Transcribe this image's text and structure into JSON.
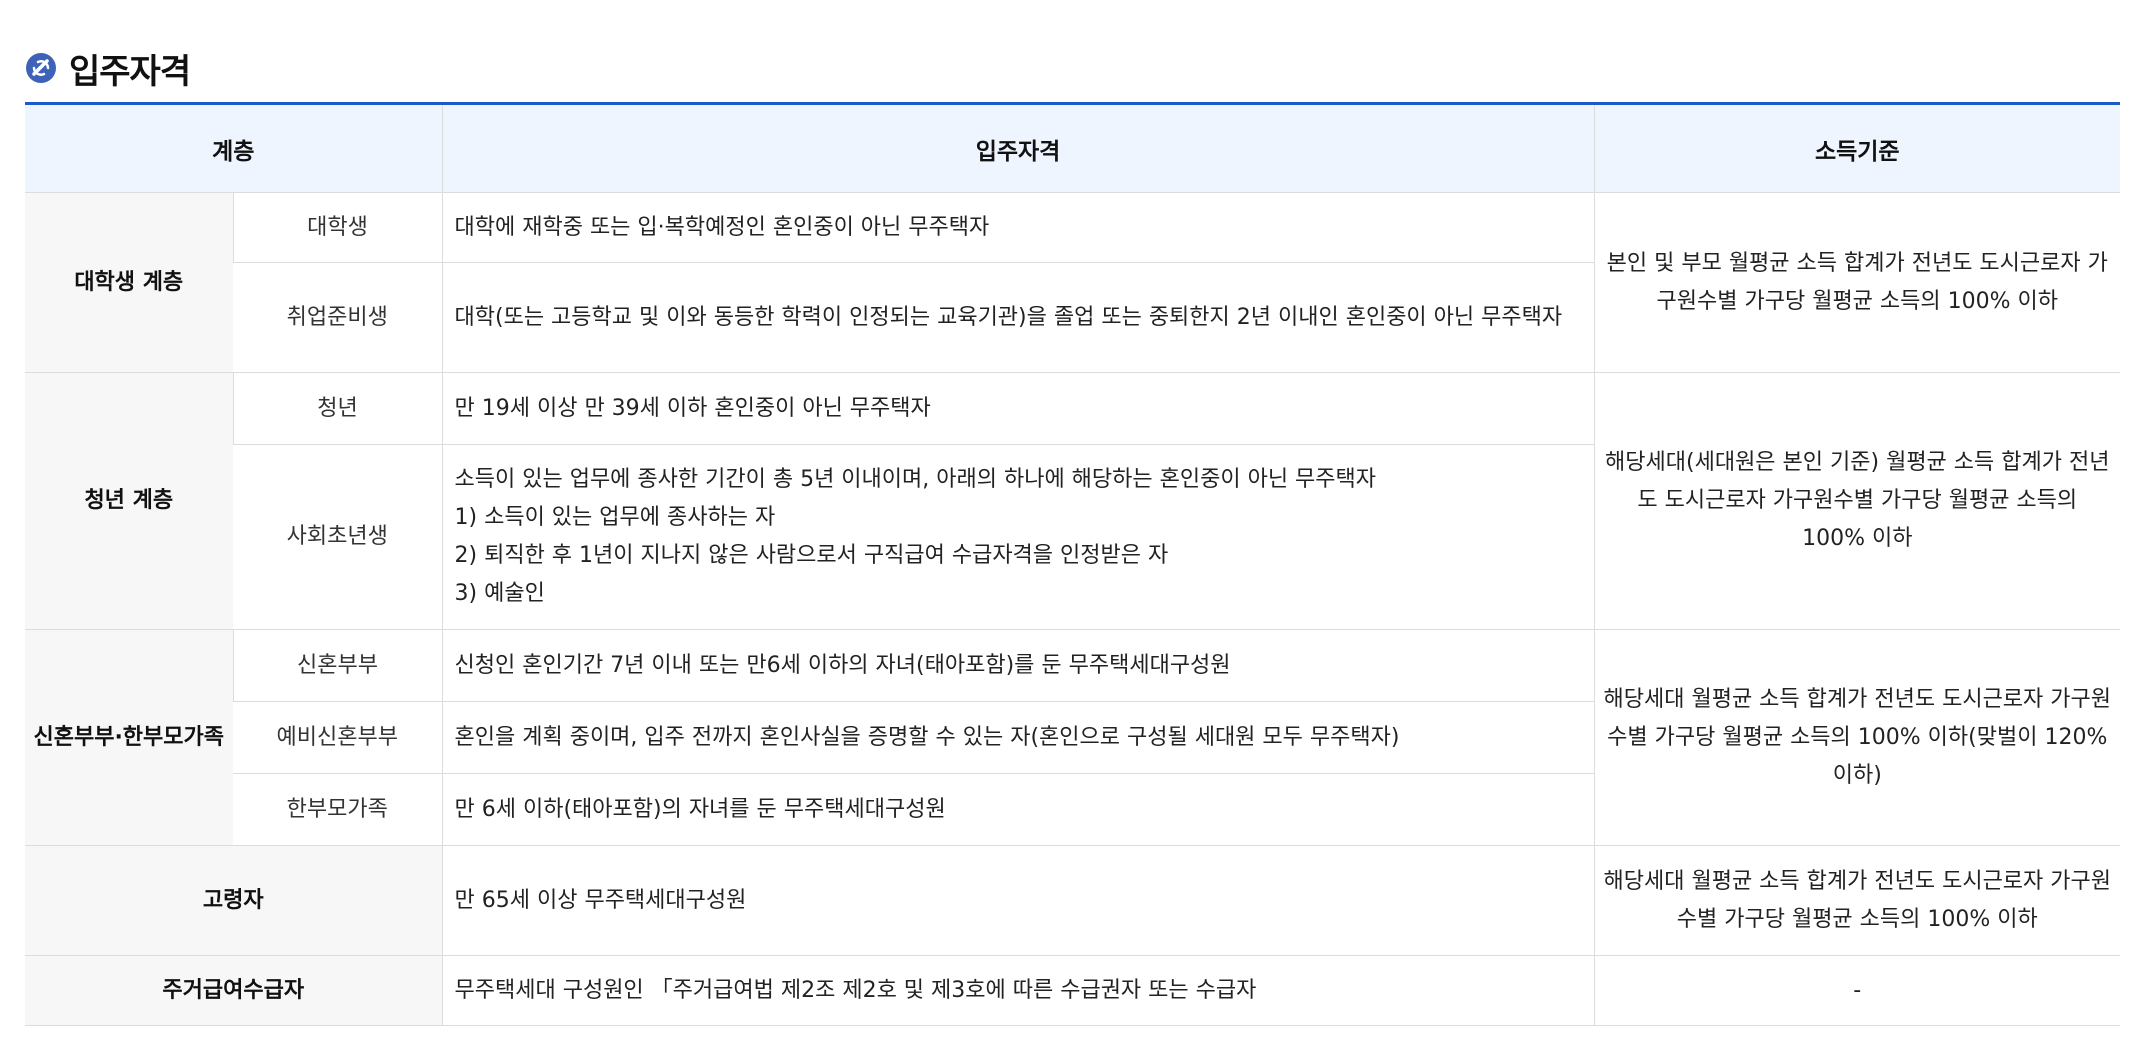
{
  "section": {
    "title": "입주자격",
    "icon": "section-title-icon",
    "accent_color": "#1f58c7"
  },
  "table": {
    "headers": [
      "계층",
      "입주자격",
      "소득기준"
    ],
    "groups": [
      {
        "category": "대학생 계층",
        "income": "본인 및 부모 월평균 소득 합계가 전년도 도시근로자 가구원수별 가구당 월평균 소득의 100% 이하",
        "rows": [
          {
            "type": "대학생",
            "qualification": [
              "대학에 재학중 또는 입·복학예정인 혼인중이 아닌 무주택자"
            ]
          },
          {
            "type": "취업준비생",
            "qualification": [
              "대학(또는 고등학교 및 이와 동등한 학력이 인정되는 교육기관)을 졸업 또는 중퇴한지 2년 이내인 혼인중이 아닌 무주택자"
            ]
          }
        ]
      },
      {
        "category": "청년 계층",
        "income": "해당세대(세대원은 본인 기준) 월평균 소득 합계가 전년도 도시근로자 가구원수별 가구당 월평균 소득의 100% 이하",
        "rows": [
          {
            "type": "청년",
            "qualification": [
              "만 19세 이상 만 39세 이하 혼인중이 아닌 무주택자"
            ]
          },
          {
            "type": "사회초년생",
            "qualification": [
              "소득이 있는 업무에 종사한 기간이 총 5년 이내이며, 아래의 하나에 해당하는 혼인중이 아닌 무주택자",
              "1) 소득이 있는 업무에 종사하는 자",
              "2) 퇴직한 후 1년이 지나지 않은 사람으로서 구직급여 수급자격을 인정받은 자",
              "3) 예술인"
            ]
          }
        ]
      },
      {
        "category": "신혼부부·한부모가족",
        "income": "해당세대 월평균 소득 합계가 전년도 도시근로자 가구원수별 가구당 월평균 소득의 100% 이하(맞벌이 120%이하)",
        "rows": [
          {
            "type": "신혼부부",
            "qualification": [
              "신청인 혼인기간 7년 이내 또는 만6세 이하의 자녀(태아포함)를 둔 무주택세대구성원"
            ]
          },
          {
            "type": "예비신혼부부",
            "qualification": [
              "혼인을 계획 중이며, 입주 전까지 혼인사실을 증명할 수 있는 자(혼인으로 구성될 세대원 모두 무주택자)"
            ]
          },
          {
            "type": "한부모가족",
            "qualification": [
              "만 6세 이하(태아포함)의 자녀를 둔 무주택세대구성원"
            ]
          }
        ]
      },
      {
        "category": "고령자",
        "income": "해당세대 월평균 소득 합계가 전년도 도시근로자 가구원수별 가구당 월평균 소득의 100% 이하",
        "qualification": "만 65세 이상 무주택세대구성원"
      },
      {
        "category": "주거급여수급자",
        "income": "-",
        "qualification": "무주택세대 구성원인 「주거급여법 제2조 제2호 및 제3호에 따른 수급권자 또는 수급자"
      }
    ]
  }
}
